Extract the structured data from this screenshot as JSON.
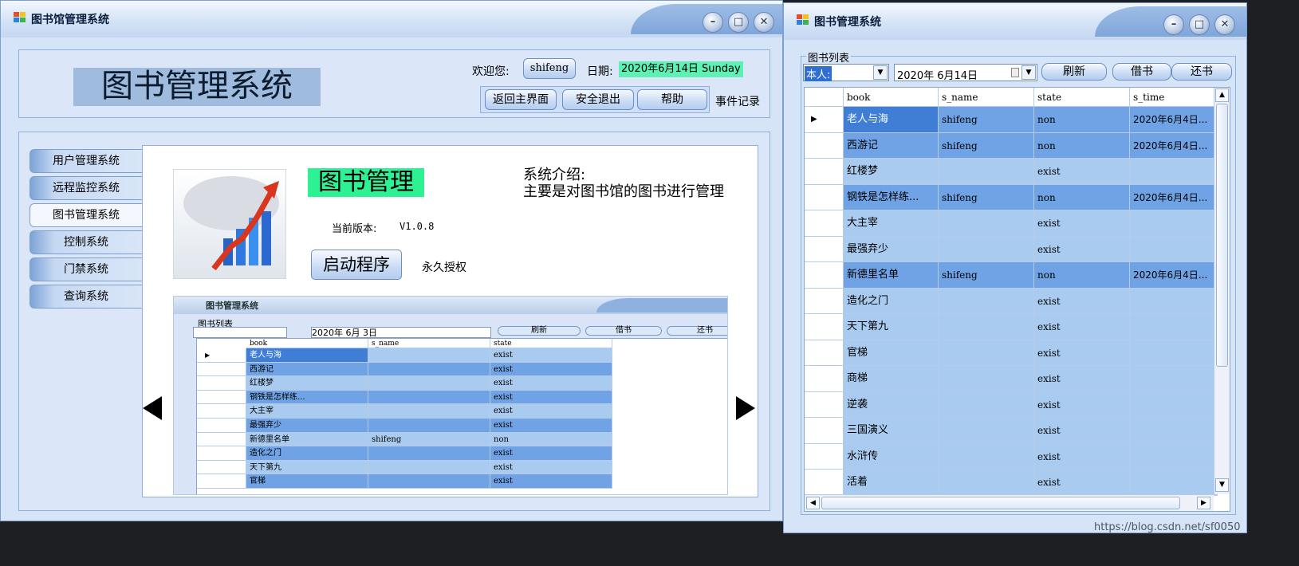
{
  "main_window": {
    "title": "图书馆管理系统",
    "min_icon": "minimize-icon",
    "max_icon": "maximize-icon",
    "close_icon": "close-icon",
    "header": {
      "app_title": "图书管理系统",
      "welcome_label": "欢迎您:",
      "user": "shifeng",
      "date_label": "日期:",
      "date_value": "2020年6月14日 Sunday",
      "buttons": [
        "返回主界面",
        "安全退出",
        "帮助"
      ],
      "event_log": "事件记录"
    },
    "sidebar": [
      "用户管理系统",
      "远程监控系统",
      "图书管理系统",
      "控制系统",
      "门禁系统",
      "查询系统"
    ],
    "sidebar_active_index": 2,
    "content": {
      "module_title": "图书管理",
      "version_label": "当前版本:",
      "version": "V1.0.8",
      "launch_button": "启动程序",
      "license": "永久授权",
      "intro_title": "系统介绍:",
      "intro_text": "主要是对图书馆的图书进行管理",
      "prev_icon": "arrow-left-icon",
      "next_icon": "arrow-right-icon"
    },
    "preview": {
      "title": "图书管理系统",
      "group_label": "图书列表",
      "date": "2020年 6月 3日",
      "buttons": [
        "刷新",
        "借书",
        "还书"
      ],
      "columns": [
        "book",
        "s_name",
        "state"
      ],
      "rows": [
        [
          "老人与海",
          "",
          "exist"
        ],
        [
          "西游记",
          "",
          "exist"
        ],
        [
          "红楼梦",
          "",
          "exist"
        ],
        [
          "钢铁是怎样练...",
          "",
          "exist"
        ],
        [
          "大主宰",
          "",
          "exist"
        ],
        [
          "最强弃少",
          "",
          "exist"
        ],
        [
          "新德里名单",
          "shifeng",
          "non"
        ],
        [
          "造化之门",
          "",
          "exist"
        ],
        [
          "天下第九",
          "",
          "exist"
        ],
        [
          "官梯",
          "",
          "exist"
        ]
      ]
    }
  },
  "book_window": {
    "title": "图书管理系统",
    "group_label": "图书列表",
    "filter_value": "本人:",
    "date_value": "2020年 6月14日",
    "buttons": [
      "刷新",
      "借书",
      "还书"
    ],
    "columns": [
      "book",
      "s_name",
      "state",
      "s_time"
    ],
    "rows": [
      [
        "老人与海",
        "shifeng",
        "non",
        "2020年6月4日..."
      ],
      [
        "西游记",
        "shifeng",
        "non",
        "2020年6月4日..."
      ],
      [
        "红楼梦",
        "",
        "exist",
        ""
      ],
      [
        "钢铁是怎样练...",
        "shifeng",
        "non",
        "2020年6月4日..."
      ],
      [
        "大主宰",
        "",
        "exist",
        ""
      ],
      [
        "最强弃少",
        "",
        "exist",
        ""
      ],
      [
        "新德里名单",
        "shifeng",
        "non",
        "2020年6月4日..."
      ],
      [
        "造化之门",
        "",
        "exist",
        ""
      ],
      [
        "天下第九",
        "",
        "exist",
        ""
      ],
      [
        "官梯",
        "",
        "exist",
        ""
      ],
      [
        "商梯",
        "",
        "exist",
        ""
      ],
      [
        "逆袭",
        "",
        "exist",
        ""
      ],
      [
        "三国演义",
        "",
        "exist",
        ""
      ],
      [
        "水浒传",
        "",
        "exist",
        ""
      ],
      [
        "活着",
        "",
        "exist",
        ""
      ]
    ],
    "selected_row": 0
  },
  "watermark": "https://blog.csdn.net/sf0050",
  "colors": {
    "row_light": "#a9cbf0",
    "row_dark": "#6fa3e6",
    "selected": "#3f7ed4",
    "date_highlight": "#5ff0b4"
  }
}
